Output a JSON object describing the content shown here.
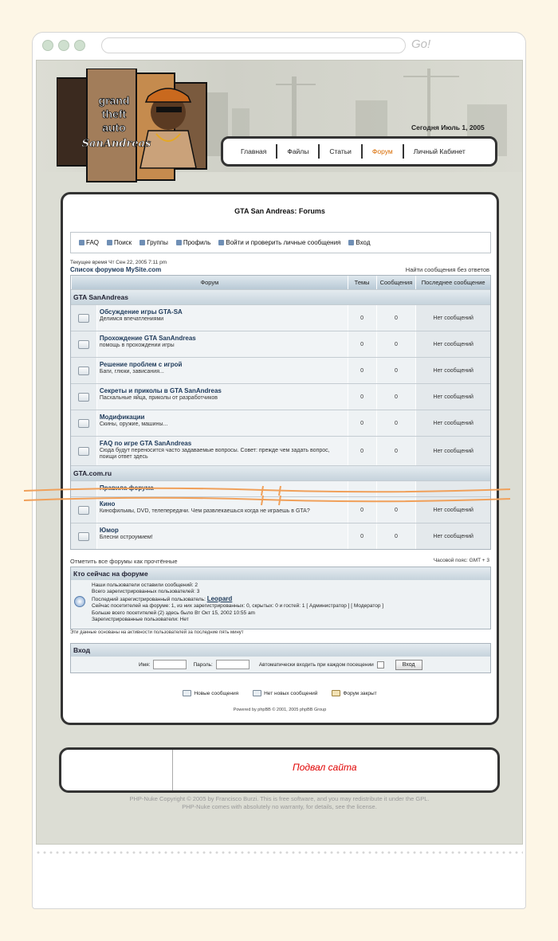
{
  "browser": {
    "go_label": "Go!"
  },
  "header": {
    "logo_alt": "Grand Theft Auto San Andreas",
    "date": "Сегодня Июль 1, 2005"
  },
  "nav": {
    "items": [
      {
        "label": "Главная",
        "active": false
      },
      {
        "label": "Файлы",
        "active": false
      },
      {
        "label": "Статьи",
        "active": false
      },
      {
        "label": "Форум",
        "active": true
      },
      {
        "label": "Личный Кабинет",
        "active": false
      }
    ]
  },
  "forum": {
    "title": "GTA San Andreas: Forums",
    "links": [
      "FAQ",
      "Поиск",
      "Группы",
      "Профиль",
      "Войти и проверить личные сообщения",
      "Вход"
    ],
    "current_time": "Текущее время Чт Сен 22, 2005 7:11 pm",
    "breadcrumb": "Список форумов MySite.com",
    "no_answers": "Найти сообщения без ответов",
    "columns": [
      "Форум",
      "Темы",
      "Сообщения",
      "Последнее сообщение"
    ],
    "categories": [
      {
        "name": "GTA SanAndreas",
        "forums": [
          {
            "name": "Обсуждение игры GTA-SA",
            "desc": "Делимся впечатлениями",
            "topics": "0",
            "posts": "0",
            "last": "Нет сообщений"
          },
          {
            "name": "Прохождение GTA SanAndreas",
            "desc": "помощь в прохождении игры",
            "topics": "0",
            "posts": "0",
            "last": "Нет сообщений"
          },
          {
            "name": "Решение проблем с игрой",
            "desc": "Баги, глюки, зависания...",
            "topics": "0",
            "posts": "0",
            "last": "Нет сообщений"
          },
          {
            "name": "Секреты и приколы в GTA SanAndreas",
            "desc": "Пасхальные яйца, приколы от разработчиков",
            "topics": "0",
            "posts": "0",
            "last": "Нет сообщений"
          },
          {
            "name": "Модификации",
            "desc": "Скины, оружие, машины...",
            "topics": "0",
            "posts": "0",
            "last": "Нет сообщений"
          },
          {
            "name": "FAQ по игре GTA SanAndreas",
            "desc": "Сюда будут переносится часто задаваемые вопросы. Совет: прежде чем задать вопрос, поищи ответ здесь",
            "topics": "0",
            "posts": "0",
            "last": "Нет сообщений"
          }
        ]
      },
      {
        "name": "GTA.com.ru",
        "forums": [
          {
            "name": "Правила форума",
            "desc": "",
            "topics": "",
            "posts": "",
            "last": ""
          },
          {
            "name": "Кино",
            "desc": "Кинофильмы, DVD, телепередачи. Чем развлекаешься когда не играешь в GTA?",
            "topics": "0",
            "posts": "0",
            "last": "Нет сообщений"
          },
          {
            "name": "Юмор",
            "desc": "Блесни остроумием!",
            "topics": "0",
            "posts": "0",
            "last": "Нет сообщений"
          }
        ]
      }
    ],
    "mark_read": "Отметить все форумы как прочтённые",
    "timezone": "Часовой пояс: GMT + 3",
    "who_online": {
      "title": "Кто сейчас на форуме",
      "line1": "Наши пользователи оставили сообщений: 2",
      "line2": "Всего зарегистрированных пользователей: 3",
      "line3_prefix": "Последний зарегистрированный пользователь: ",
      "last_user": "Leopard",
      "line4": "Сейчас посетителей на форуме: 1, из них зарегистрированных: 0, скрытых: 0 и гостей: 1   [ Администратор ]   [ Модератор ]",
      "line5": "Больше всего посетителей (2) здесь было Вт Окт 15, 2002 10:55 am",
      "line6": "Зарегистрированные пользователи: Нет"
    },
    "based_note": "Эти данные основаны на активности пользователей за последние пять минут",
    "login": {
      "title": "Вход",
      "name_label": "Имя:",
      "password_label": "Пароль:",
      "auto_label": "Автоматически входить при каждом посещении",
      "button": "Вход"
    },
    "legend": [
      "Новые сообщения",
      "Нет новых сообщений",
      "Форум закрыт"
    ],
    "powered": "Powered by phpBB © 2001, 2005 phpBB Group"
  },
  "footer": {
    "title": "Подвал сайта",
    "copyright1": "PHP-Nuke Copyright © 2005 by Francisco Burzi. This is free software, and you may redistribute it under the GPL.",
    "copyright2": "PHP-Nuke comes with absolutely no warranty, for details, see the license."
  },
  "colors": {
    "accent_orange": "#d96b00",
    "footer_red": "#e00000",
    "frame": "#333333"
  }
}
